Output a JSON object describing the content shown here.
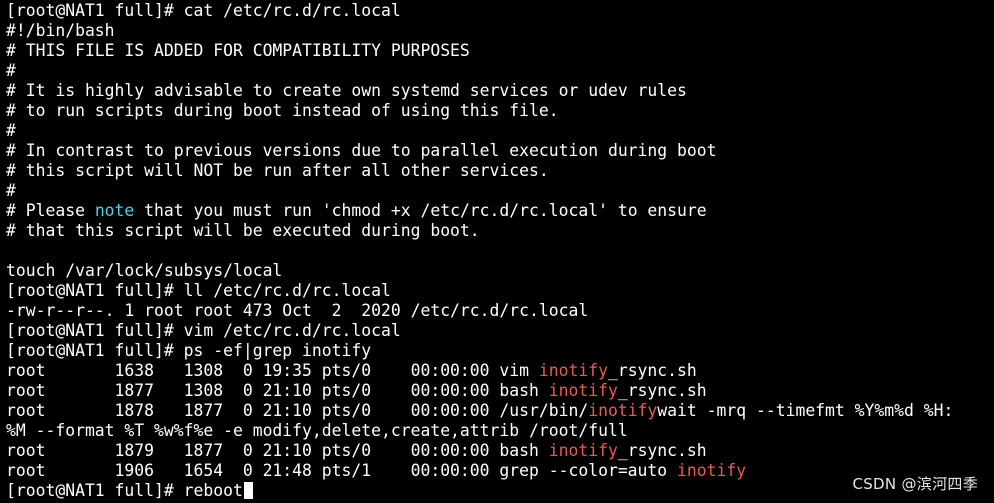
{
  "colors": {
    "background": "#000000",
    "foreground": "#ffffff",
    "note_highlight": "#47d4e8",
    "inotify_highlight": "#e35d52"
  },
  "lines": [
    [
      {
        "t": "[root@NAT1 full]# cat /etc/rc.d/rc.local"
      }
    ],
    [
      {
        "t": "#!/bin/bash"
      }
    ],
    [
      {
        "t": "# THIS FILE IS ADDED FOR COMPATIBILITY PURPOSES"
      }
    ],
    [
      {
        "t": "#"
      }
    ],
    [
      {
        "t": "# It is highly advisable to create own systemd services or udev rules"
      }
    ],
    [
      {
        "t": "# to run scripts during boot instead of using this file."
      }
    ],
    [
      {
        "t": "#"
      }
    ],
    [
      {
        "t": "# In contrast to previous versions due to parallel execution during boot"
      }
    ],
    [
      {
        "t": "# this script will NOT be run after all other services."
      }
    ],
    [
      {
        "t": "#"
      }
    ],
    [
      {
        "t": "# Please "
      },
      {
        "t": "note",
        "c": "hl-note"
      },
      {
        "t": " that you must run 'chmod +x /etc/rc.d/rc.local' to ensure"
      }
    ],
    [
      {
        "t": "# that this script will be executed during boot."
      }
    ],
    [
      {
        "t": ""
      }
    ],
    [
      {
        "t": "touch /var/lock/subsys/local"
      }
    ],
    [
      {
        "t": "[root@NAT1 full]# ll /etc/rc.d/rc.local"
      }
    ],
    [
      {
        "t": "-rw-r--r--. 1 root root 473 Oct  2  2020 /etc/rc.d/rc.local"
      }
    ],
    [
      {
        "t": "[root@NAT1 full]# vim /etc/rc.d/rc.local"
      }
    ],
    [
      {
        "t": "[root@NAT1 full]# ps -ef|grep inotify"
      }
    ],
    [
      {
        "t": "root       1638   1308  0 19:35 pts/0    00:00:00 vim "
      },
      {
        "t": "inotify",
        "c": "hl-inotify"
      },
      {
        "t": "_rsync.sh"
      }
    ],
    [
      {
        "t": "root       1877   1308  0 21:10 pts/0    00:00:00 bash "
      },
      {
        "t": "inotify",
        "c": "hl-inotify"
      },
      {
        "t": "_rsync.sh"
      }
    ],
    [
      {
        "t": "root       1878   1877  0 21:10 pts/0    00:00:00 /usr/bin/"
      },
      {
        "t": "inotify",
        "c": "hl-inotify"
      },
      {
        "t": "wait -mrq --timefmt %Y%m%d %H:"
      }
    ],
    [
      {
        "t": "%M --format %T %w%f%e -e modify,delete,create,attrib /root/full"
      }
    ],
    [
      {
        "t": "root       1879   1877  0 21:10 pts/0    00:00:00 bash "
      },
      {
        "t": "inotify",
        "c": "hl-inotify"
      },
      {
        "t": "_rsync.sh"
      }
    ],
    [
      {
        "t": "root       1906   1654  0 21:48 pts/1    00:00:00 grep --color=auto "
      },
      {
        "t": "inotify",
        "c": "hl-inotify"
      }
    ],
    [
      {
        "t": "[root@NAT1 full]# reboot"
      }
    ]
  ],
  "watermark": "CSDN @滨河四季"
}
